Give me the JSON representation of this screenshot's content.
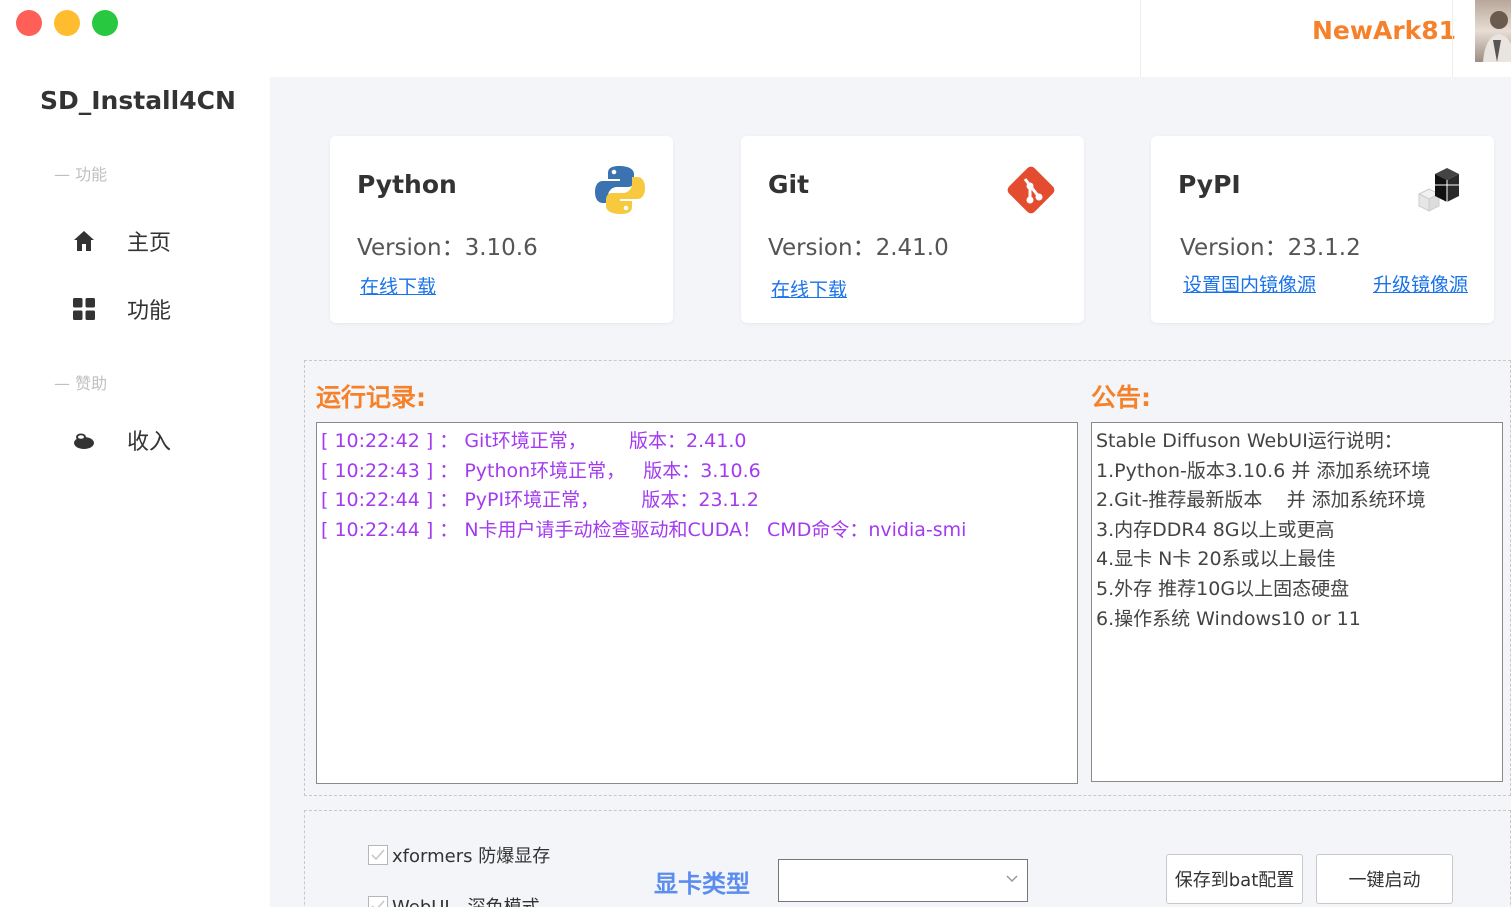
{
  "sidebar": {
    "app_title": "SD_Install4CN",
    "groups": [
      {
        "label": "— 功能"
      },
      {
        "label": "— 赞助"
      }
    ],
    "items": [
      {
        "label": "主页",
        "icon": "home-icon"
      },
      {
        "label": "功能",
        "icon": "grid-icon"
      },
      {
        "label": "收入",
        "icon": "coins-icon"
      }
    ]
  },
  "header": {
    "username": "NewArk81"
  },
  "cards": [
    {
      "title": "Python",
      "version": "Version：3.10.6",
      "links": [
        "在线下载"
      ],
      "icon": "python-icon"
    },
    {
      "title": "Git",
      "version": "Version：2.41.0",
      "links": [
        "在线下载"
      ],
      "icon": "git-icon"
    },
    {
      "title": "PyPI",
      "version": "Version：23.1.2",
      "links": [
        "设置国内镜像源",
        "升级镜像源"
      ],
      "icon": "pypi-icon"
    }
  ],
  "log": {
    "title": "运行记录:",
    "lines": [
      "[ 10:22:42 ] ： Git环境正常，       版本：2.41.0",
      "[ 10:22:43 ] ： Python环境正常，   版本：3.10.6",
      "[ 10:22:44 ] ： PyPI环境正常，       版本：23.1.2",
      "[ 10:22:44 ] ： N卡用户请手动检查驱动和CUDA！ CMD命令：nvidia-smi"
    ]
  },
  "notice": {
    "title": "公告:",
    "lines": [
      "Stable Diffuson WebUI运行说明：",
      "",
      "1.Python-版本3.10.6 并 添加系统环境",
      "2.Git-推荐最新版本    并 添加系统环境",
      "3.内存DDR4 8G以上或更高",
      "4.显卡 N卡 20系或以上最佳",
      "5.外存 推荐10G以上固态硬盘",
      "6.操作系统 Windows10 or 11"
    ]
  },
  "options": {
    "checkbox1": "xformers 防爆显存",
    "checkbox2": "WebUI - 深色模式",
    "gpu_label": "显卡类型",
    "gpu_select_value": "",
    "save_button": "保存到bat配置",
    "launch_button": "一键启动"
  }
}
